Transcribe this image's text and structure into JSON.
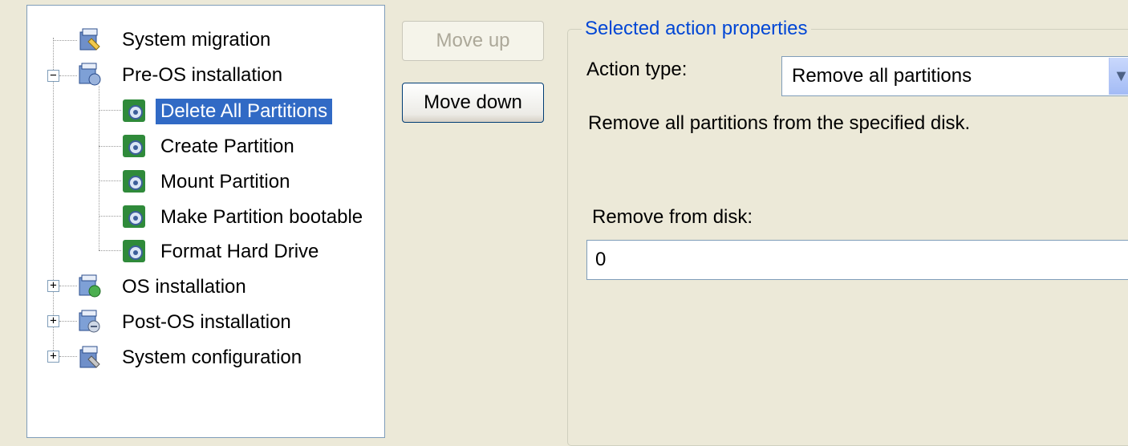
{
  "tree": {
    "items": [
      {
        "label": "System migration",
        "icon": "system-migration-icon",
        "expander": ""
      },
      {
        "label": "Pre-OS installation",
        "icon": "pre-os-icon",
        "expander": "−"
      },
      {
        "label": "Delete All Partitions",
        "icon": "action-gear-icon",
        "selected": true
      },
      {
        "label": "Create Partition",
        "icon": "action-gear-icon"
      },
      {
        "label": "Mount Partition",
        "icon": "action-gear-icon"
      },
      {
        "label": "Make Partition bootable",
        "icon": "action-gear-icon"
      },
      {
        "label": "Format Hard Drive",
        "icon": "action-gear-icon"
      },
      {
        "label": "OS installation",
        "icon": "os-install-icon",
        "expander": "+"
      },
      {
        "label": "Post-OS installation",
        "icon": "post-os-icon",
        "expander": "+"
      },
      {
        "label": "System configuration",
        "icon": "system-config-icon",
        "expander": "+"
      }
    ]
  },
  "buttons": {
    "move_up": "Move up",
    "move_down": "Move down"
  },
  "properties": {
    "title": "Selected action properties",
    "action_type_label": "Action type:",
    "action_type_value": "Remove all partitions",
    "description": "Remove all partitions from the specified disk.",
    "remove_from_label": "Remove from disk:",
    "remove_from_value": "0"
  },
  "colors": {
    "selection": "#316ac5",
    "group_title": "#0046d5",
    "background": "#ece9d8"
  }
}
